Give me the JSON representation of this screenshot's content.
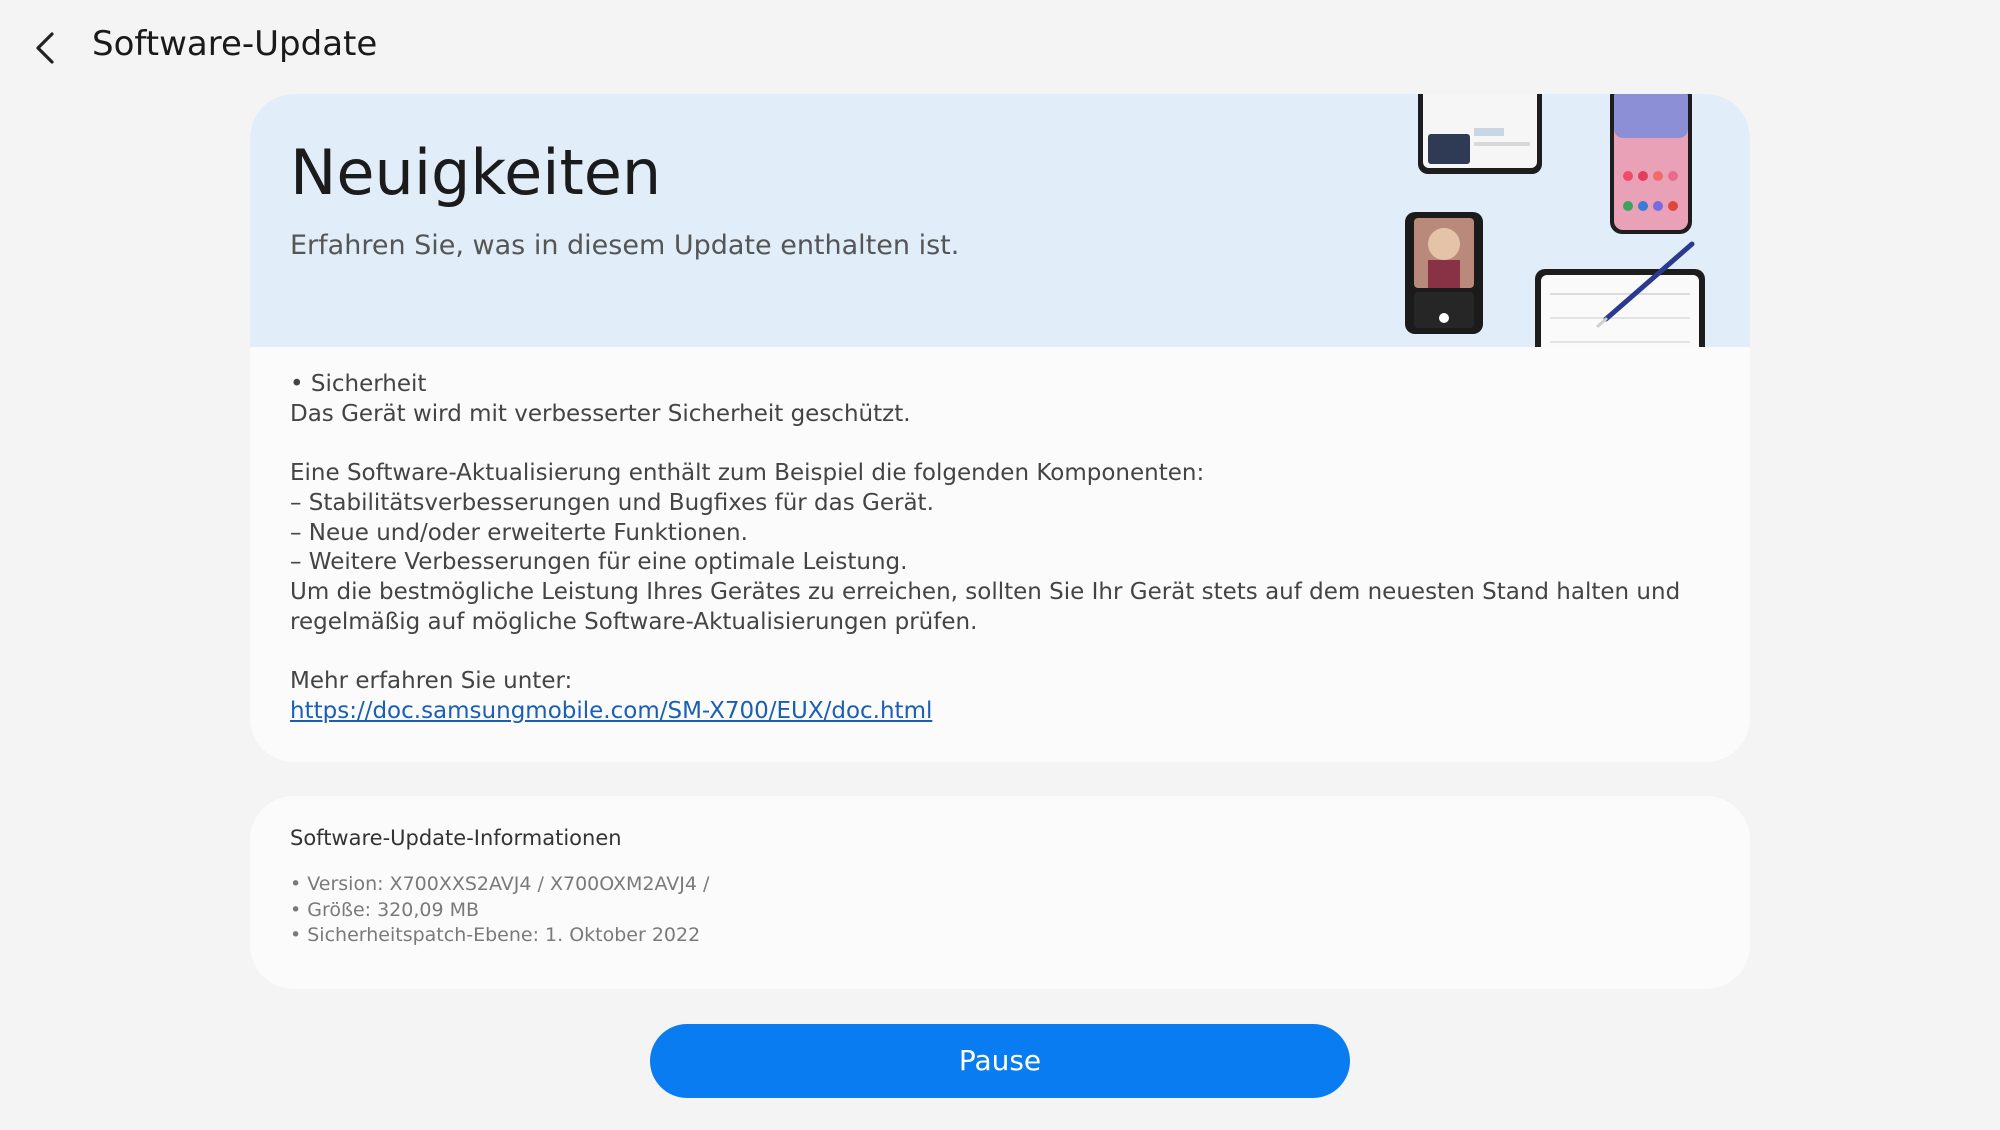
{
  "header": {
    "title": "Software-Update",
    "back_icon": "chevron-left-icon"
  },
  "news": {
    "banner_title": "Neuigkeiten",
    "banner_subtitle": "Erfahren Sie, was in diesem Update enthalten ist.",
    "banner_color": "#e1eef9",
    "lines": [
      "• Sicherheit",
      "Das Gerät wird mit verbesserter Sicherheit geschützt.",
      "",
      "Eine Software-Aktualisierung enthält zum Beispiel die folgenden Komponenten:",
      " – Stabilitätsverbesserungen und Bugfixes für das Gerät.",
      " – Neue und/oder erweiterte Funktionen.",
      " – Weitere Verbesserungen für eine optimale Leistung.",
      "Um die bestmögliche Leistung Ihres Gerätes zu erreichen, sollten Sie Ihr Gerät stets auf dem neuesten Stand halten und",
      "regelmäßig auf mögliche Software-Aktualisierungen prüfen.",
      "",
      "Mehr erfahren Sie unter:"
    ],
    "link": "https://doc.samsungmobile.com/SM-X700/EUX/doc.html"
  },
  "info": {
    "heading": "Software-Update-Informationen",
    "items": [
      "• Version: X700XXS2AVJ4 / X700OXM2AVJ4 /",
      "• Größe: 320,09 MB",
      "• Sicherheitspatch-Ebene: 1. Oktober 2022"
    ]
  },
  "actions": {
    "pause_label": "Pause",
    "accent_color": "#0a7cf2"
  }
}
